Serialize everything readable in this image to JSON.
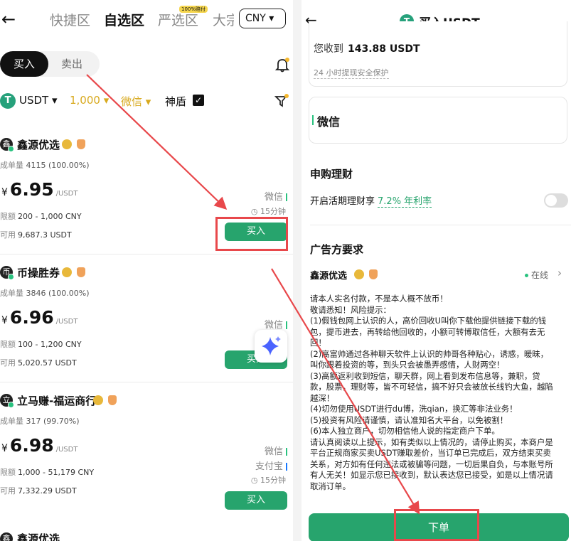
{
  "left": {
    "nav": {
      "back": "←",
      "tabs": [
        "快捷区",
        "自选区",
        "严选区",
        "大宗"
      ],
      "active_tab": 1,
      "badge": "100%赔付",
      "currency": "CNY ▾"
    },
    "buy_label": "买入",
    "sell_label": "卖出",
    "filters": {
      "coin": "USDT",
      "amount": "1,000",
      "payment": "微信",
      "shield": "神盾"
    },
    "cards": [
      {
        "avatar": "鑫",
        "name": "鑫源优选",
        "stats_label": "成单量",
        "stats_value": "4115 (100.00%)",
        "yen": "¥",
        "price": "6.95",
        "unit": "/USDT",
        "limit_label": "限额",
        "limit": "200 - 1,000 CNY",
        "avail_label": "可用",
        "avail": "9,687.3 USDT",
        "pays": [
          "微信"
        ],
        "time": "15分钟",
        "button": "买入"
      },
      {
        "avatar": "币",
        "name": "币操胜券",
        "stats_label": "成单量",
        "stats_value": "3846 (100.00%)",
        "yen": "¥",
        "price": "6.96",
        "unit": "/USDT",
        "limit_label": "限额",
        "limit": "100 - 1,200 CNY",
        "avail_label": "可用",
        "avail": "5,020.57 USDT",
        "pays": [
          "微信"
        ],
        "time": "",
        "button": "买入"
      },
      {
        "avatar": "立",
        "name": "立马赚-福运商行",
        "stats_label": "成单量",
        "stats_value": "317 (99.70%)",
        "yen": "¥",
        "price": "6.98",
        "unit": "/USDT",
        "limit_label": "限额",
        "limit": "1,000 - 51,179 CNY",
        "avail_label": "可用",
        "avail": "7,332.29 USDT",
        "pays": [
          "微信",
          "支付宝"
        ],
        "time": "15分钟",
        "button": "买入"
      },
      {
        "avatar": "鑫",
        "name": "鑫源优选"
      }
    ]
  },
  "right": {
    "back": "←",
    "title": "买入USDT",
    "receive_label": "您收到",
    "receive_value": "143.88 USDT",
    "safety": "24 小时提现安全保护",
    "payment_method": "微信",
    "finance_title": "申购理财",
    "finance_row": "开启活期理财享",
    "finance_rate": "7.2% 年利率",
    "req_title": "广告方要求",
    "merchant": "鑫源优选",
    "online": "在线",
    "terms": [
      "请本人实名付款，不是本人概不放币！",
      "敬请悉知！风险提示：",
      "(1)假钱包网上认识的人，高价回收U叫你下载他提供链接下载的钱",
      "包，提币进去，再转给他回收的，小额可转博取信任，大额有去无",
      "回！",
      "(2)高富帅通过各种聊天软件上认识的帅哥各种贴心，诱惑，暖昧，",
      "叫你跟着投资的等，到头只会被愚弄感情，人财两空！",
      "(3)高额返利收到短信，聊天群，网上看到发布信息等，兼职，贷",
      "款，股票，理财等，皆不可轻信，搞不好只会被放长线钓大鱼，越陷",
      "越深！",
      "(4)切勿使用USDT进行du博，洗qian，换汇等非法业务！",
      "(5)投资有风险请谨慎，请认准知名大平台，以免被割！",
      "(6)本人独立商户，切勿相信他人说的指定商户下单。",
      "请认真阅读以上提示，如有类似以上情况的，请停止购买，本商户是",
      "平台正规商家买卖USDT赚取差价，当订单已完成后，双方结束买卖",
      "关系，对方如有任何违法或被骗等问题，一切后果自负，与本账号所",
      "有人无关！如显示您已接收到，默认表达您已接受，如是以上情况请",
      "取消订单。"
    ],
    "order_button": "下单"
  },
  "annotation_color": "#e8484b"
}
